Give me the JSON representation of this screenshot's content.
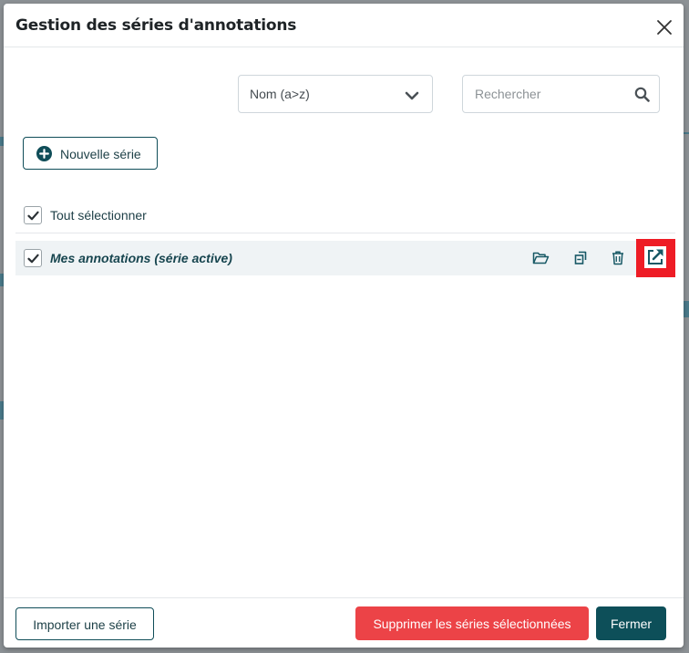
{
  "dialog": {
    "title": "Gestion des séries d'annotations"
  },
  "toolbar": {
    "sort_value": "Nom (a>z)",
    "search_placeholder": "Rechercher"
  },
  "actions": {
    "new_series_label": "Nouvelle série"
  },
  "list": {
    "select_all_label": "Tout sélectionner",
    "select_all_checked": true,
    "items": [
      {
        "label": "Mes annotations (série active)",
        "checked": true,
        "icons": [
          "folder-open-icon",
          "copy-icon",
          "trash-icon",
          "external-link-icon"
        ]
      }
    ]
  },
  "footer": {
    "import_label": "Importer une série",
    "delete_label": "Supprimer les séries sélectionnées",
    "close_label": "Fermer"
  },
  "colors": {
    "primary": "#0d4f59",
    "danger": "#ec4347",
    "highlight": "#ee1c25",
    "row_bg": "#eff3f5"
  }
}
